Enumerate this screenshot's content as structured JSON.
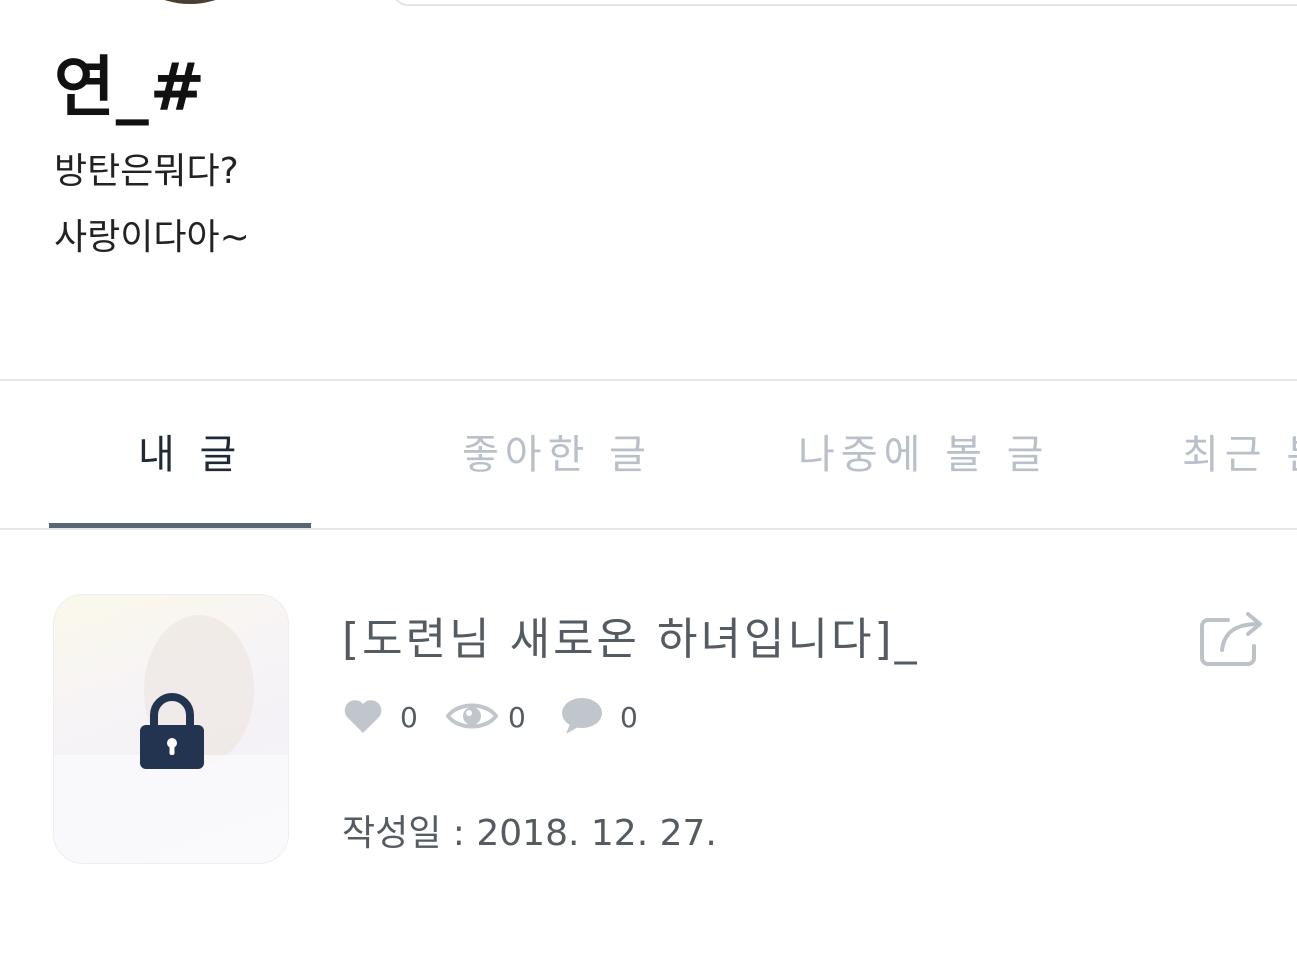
{
  "profile": {
    "name": "연_#",
    "bio_line1": "방탄은뭐다?",
    "bio_line2": "사랑이다아~"
  },
  "tabs": [
    {
      "label": "내 글",
      "active": true
    },
    {
      "label": "좋아한 글",
      "active": false
    },
    {
      "label": "나중에 볼 글",
      "active": false
    },
    {
      "label": "최근 본",
      "active": false
    }
  ],
  "post": {
    "title": "[도련님 새로온 하녀입니다]_",
    "likes": "0",
    "views": "0",
    "comments": "0",
    "date": "작성일 : 2018. 12. 27.",
    "locked": true
  },
  "colors": {
    "active_tab": "#1f2a36",
    "inactive_tab": "#b9c0c9",
    "indicator": "#5a6675",
    "lock": "#22344f",
    "icon_gray": "#c0c6cc"
  }
}
